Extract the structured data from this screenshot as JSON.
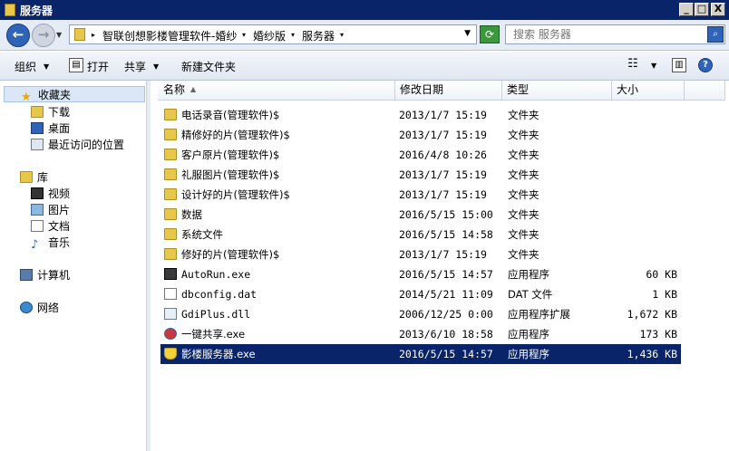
{
  "window": {
    "title": "服务器"
  },
  "window_buttons": {
    "minimize": "_",
    "maximize": "□",
    "close": "X"
  },
  "address": {
    "breadcrumbs": [
      "智联创想影楼管理软件-婚纱",
      "婚纱版",
      "服务器"
    ],
    "search_placeholder": "搜索 服务器"
  },
  "toolbar": {
    "organize": "组织",
    "open": "打开",
    "share": "共享",
    "new_folder": "新建文件夹"
  },
  "sidebar": {
    "favorites": "收藏夹",
    "fav_items": [
      "下载",
      "桌面",
      "最近访问的位置"
    ],
    "libraries": "库",
    "lib_items": [
      "视频",
      "图片",
      "文档",
      "音乐"
    ],
    "computer": "计算机",
    "network": "网络"
  },
  "columns": {
    "name": "名称",
    "date": "修改日期",
    "type": "类型",
    "size": "大小"
  },
  "files": [
    {
      "name": "电话录音(管理软件)$",
      "date": "2013/1/7 15:19",
      "type": "文件夹",
      "size": "",
      "icon": "folder-icon"
    },
    {
      "name": "精修好的片(管理软件)$",
      "date": "2013/1/7 15:19",
      "type": "文件夹",
      "size": "",
      "icon": "folder-icon"
    },
    {
      "name": "客户原片(管理软件)$",
      "date": "2016/4/8 10:26",
      "type": "文件夹",
      "size": "",
      "icon": "folder-icon"
    },
    {
      "name": "礼服图片(管理软件)$",
      "date": "2013/1/7 15:19",
      "type": "文件夹",
      "size": "",
      "icon": "folder-icon"
    },
    {
      "name": "设计好的片(管理软件)$",
      "date": "2013/1/7 15:19",
      "type": "文件夹",
      "size": "",
      "icon": "folder-icon"
    },
    {
      "name": "数据",
      "date": "2016/5/15 15:00",
      "type": "文件夹",
      "size": "",
      "icon": "folder-icon"
    },
    {
      "name": "系统文件",
      "date": "2016/5/15 14:58",
      "type": "文件夹",
      "size": "",
      "icon": "folder-icon"
    },
    {
      "name": "修好的片(管理软件)$",
      "date": "2013/1/7 15:19",
      "type": "文件夹",
      "size": "",
      "icon": "folder-icon"
    },
    {
      "name": "AutoRun.exe",
      "date": "2016/5/15 14:57",
      "type": "应用程序",
      "size": "60 KB",
      "icon": "exe-icon"
    },
    {
      "name": "dbconfig.dat",
      "date": "2014/5/21 11:09",
      "type": "DAT 文件",
      "size": "1 KB",
      "icon": "file-icon"
    },
    {
      "name": "GdiPlus.dll",
      "date": "2006/12/25 0:00",
      "type": "应用程序扩展",
      "size": "1,672 KB",
      "icon": "dll-icon"
    },
    {
      "name": "一键共享.exe",
      "date": "2013/6/10 18:58",
      "type": "应用程序",
      "size": "173 KB",
      "icon": "share-app-icon"
    },
    {
      "name": "影楼服务器.exe",
      "date": "2016/5/15 14:57",
      "type": "应用程序",
      "size": "1,436 KB",
      "icon": "shield-app-icon",
      "selected": true
    }
  ]
}
